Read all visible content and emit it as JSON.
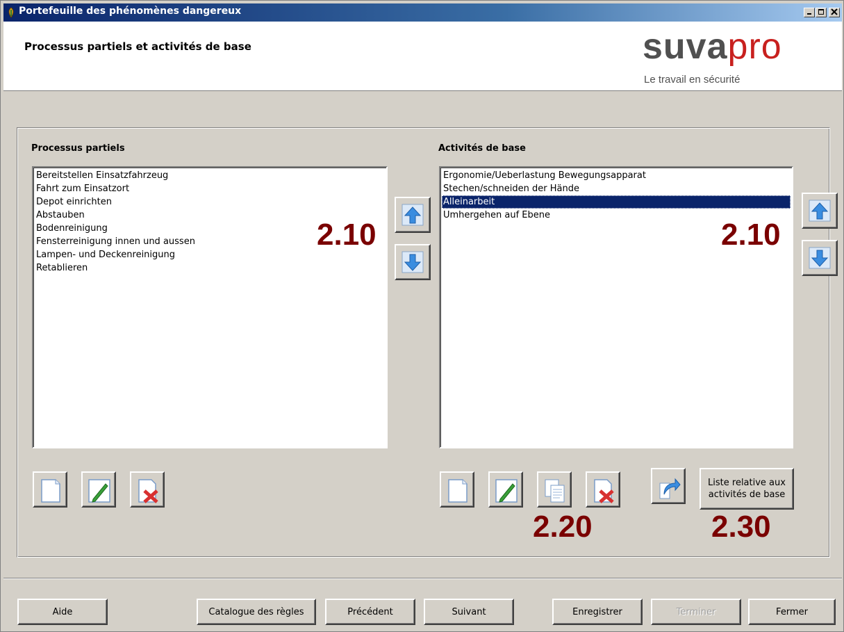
{
  "window": {
    "title": "Portefeuille des phénomènes dangereux"
  },
  "header": {
    "page_title": "Processus partiels et activités de base",
    "logo_suva": "suva",
    "logo_pro": "pro",
    "tagline": "Le travail en sécurité"
  },
  "left": {
    "label": "Processus partiels",
    "items": [
      "Bereitstellen Einsatzfahrzeug",
      "Fahrt zum Einsatzort",
      "Depot einrichten",
      "Abstauben",
      "Bodenreinigung",
      "Fensterreinigung innen und aussen",
      "Lampen- und Deckenreinigung",
      "Retablieren"
    ],
    "annotation": "2.10"
  },
  "right": {
    "label": "Activités de base",
    "items": [
      "Ergonomie/Ueberlastung Bewegungsapparat",
      "Stechen/schneiden der Hände",
      "Alleinarbeit",
      "Umhergehen auf Ebene"
    ],
    "selected_index": 2,
    "annotation": "2.10",
    "annotation_actions": "2.20",
    "annotation_list": "2.30",
    "list_button": "Liste relative aux activités de base"
  },
  "footer": {
    "help": "Aide",
    "catalog": "Catalogue des règles",
    "previous": "Précédent",
    "next": "Suivant",
    "save": "Enregistrer",
    "finish": "Terminer",
    "close": "Fermer"
  },
  "colors": {
    "annotation": "#7a0000",
    "selection": "#0a246a",
    "brand_red": "#c8201e"
  }
}
